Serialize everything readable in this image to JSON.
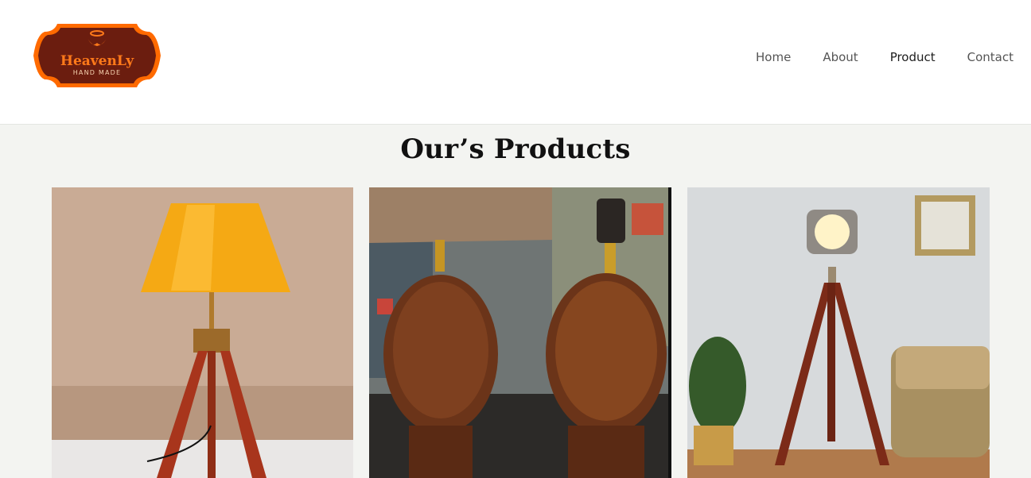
{
  "brand": {
    "logo_text": "HeavenLy",
    "logo_subtext": "HAND MADE",
    "colors": {
      "orange": "#ff6a00",
      "dark": "#6b1d0f"
    }
  },
  "nav": {
    "items": [
      {
        "label": "Home"
      },
      {
        "label": "About"
      },
      {
        "label": "Product",
        "active": true
      },
      {
        "label": "Contact"
      }
    ]
  },
  "products_section": {
    "title": "Our’s Products",
    "cards": [
      {
        "image": "tripod-table-lamp-yellow-shade"
      },
      {
        "image": "carved-wooden-lamp-bases-pair"
      },
      {
        "image": "tripod-floor-spotlight-lamp"
      }
    ]
  }
}
